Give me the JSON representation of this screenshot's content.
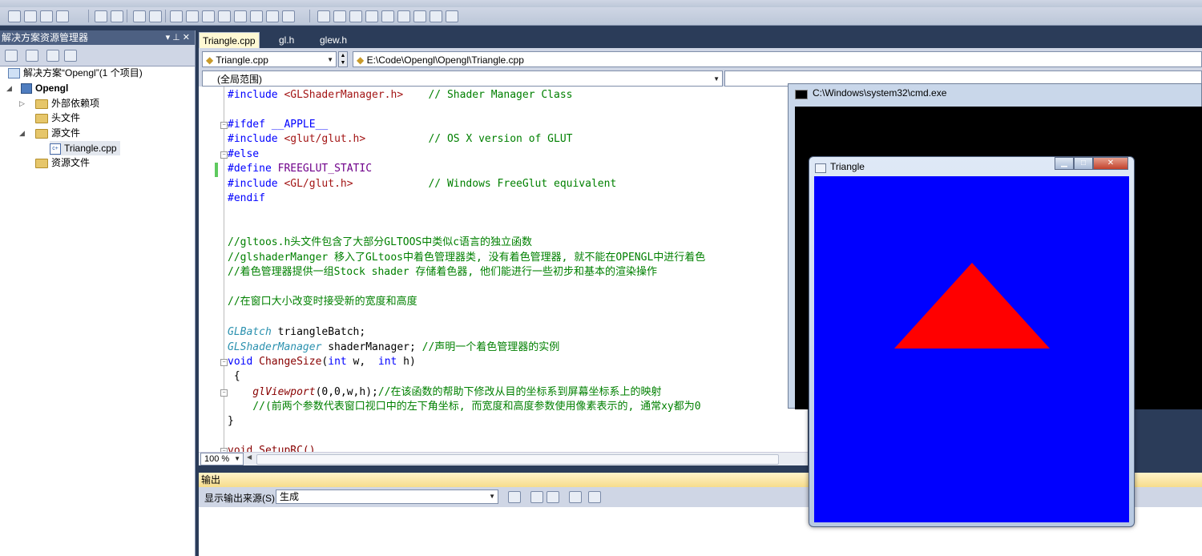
{
  "colors": {
    "ide_bg": "#2b3c59",
    "gl_clear": "#0000ff",
    "triangle": "#ff0000",
    "console_bg": "#000000"
  },
  "solution_explorer": {
    "title": "解决方案资源管理器",
    "pin_label": "▾ ⊥ ✕",
    "items": [
      {
        "label": "解决方案“Opengl”(1 个项目)"
      },
      {
        "label": "Opengl"
      },
      {
        "label": "外部依赖项"
      },
      {
        "label": "头文件"
      },
      {
        "label": "源文件"
      },
      {
        "label": "Triangle.cpp"
      },
      {
        "label": "资源文件"
      }
    ]
  },
  "editor": {
    "tabs": [
      "Triangle.cpp",
      "gl.h",
      "glew.h"
    ],
    "file_combo": "Triangle.cpp",
    "path_combo": "E:\\Code\\Opengl\\Opengl\\Triangle.cpp",
    "scope_combo": "(全局范围)",
    "zoom": "100 %",
    "code": {
      "l1a": "#include ",
      "l1b": "<GLShaderManager.h>",
      "l1c": "    // Shader Manager Class",
      "l2": "#ifdef __APPLE__",
      "l3a": "#include ",
      "l3b": "<glut/glut.h>",
      "l3c": "          // OS X version of GLUT",
      "l4": "#else",
      "l5a": "#define ",
      "l5b": "FREEGLUT_STATIC",
      "l6a": "#include ",
      "l6b": "<GL/glut.h>",
      "l6c": "            // Windows FreeGlut equivalent",
      "l7": "#endif",
      "l8": "//gltoos.h头文件包含了大部分GLTOOS中类似c语言的独立函数",
      "l9": "//glshaderManger 移入了GLtoos中着色管理器类, 没有着色管理器, 就不能在OPENGL中进行着色",
      "l10": "//着色管理器提供一组Stock shader 存储着色器, 他们能进行一些初步和基本的渲染操作",
      "l11": "//在窗口大小改变时接受新的宽度和高度",
      "l12a": "GLBatch",
      "l12b": " triangleBatch;",
      "l13a": "GLShaderManager",
      "l13b": " shaderManager; ",
      "l13c": "//声明一个着色管理器的实例",
      "l14a": "void ",
      "l14b": "ChangeSize",
      "l14c": "(",
      "l14d": "int",
      "l14e": " w,  ",
      "l14f": "int",
      "l14g": " h)",
      "l15": " {",
      "l16a": "    glViewport",
      "l16b": "(0,0,w,h);",
      "l16c": "//在该函数的帮助下修改从目的坐标系到屏幕坐标系上的映射",
      "l17": "    //(前两个参数代表窗口视口中的左下角坐标, 而宽度和高度参数使用像素表示的, 通常xy都为0",
      "l18": "}",
      "l19": "void SetupRC()"
    }
  },
  "output": {
    "title": "输出",
    "source_label": "显示输出来源(S):",
    "source_value": "生成"
  },
  "cmd_window": {
    "title": "C:\\Windows\\system32\\cmd.exe"
  },
  "gl_window": {
    "title": "Triangle",
    "triangle": {
      "shape": "triangle",
      "fill": "#ff0000"
    }
  }
}
